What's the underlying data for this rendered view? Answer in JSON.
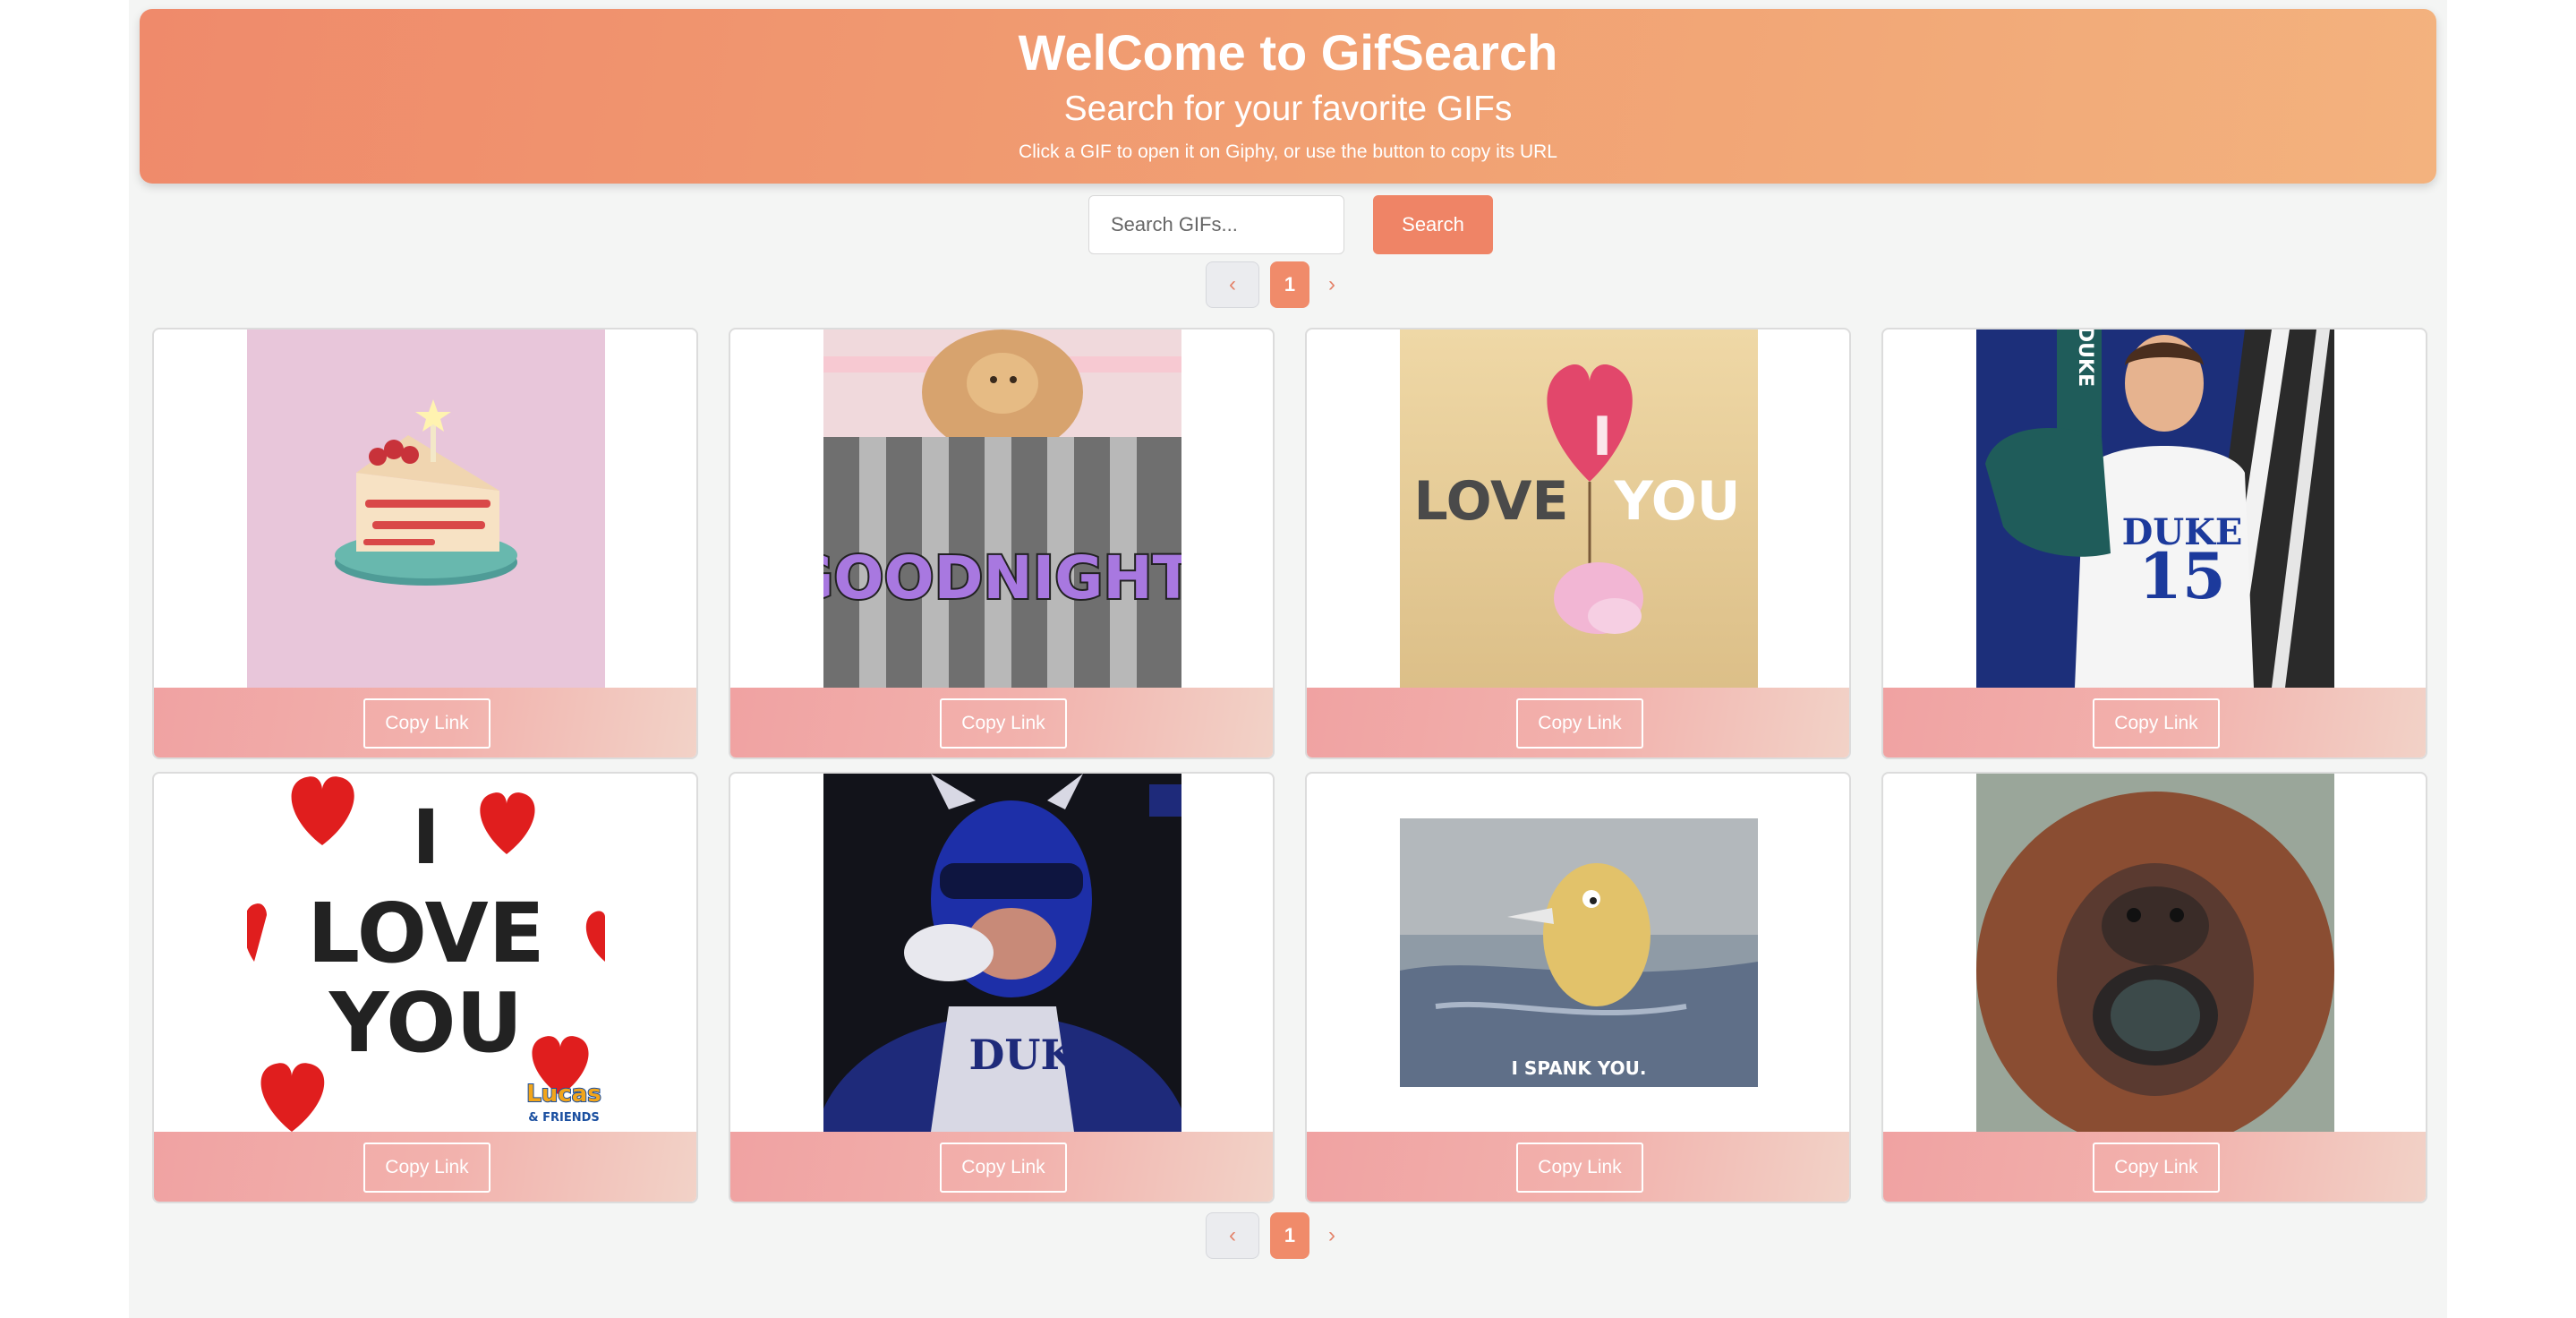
{
  "header": {
    "title": "WelCome to GifSearch",
    "subtitle": "Search for your favorite GIFs",
    "hint": "Click a GIF to open it on Giphy, or use the button to copy its URL"
  },
  "search": {
    "placeholder": "Search GIFs...",
    "value": "",
    "button_label": "Search"
  },
  "pagination": {
    "prev": "‹",
    "current_page": "1",
    "next": "›"
  },
  "gifs": [
    {
      "copy_label": "Copy Link"
    },
    {
      "copy_label": "Copy Link",
      "caption": "GOODNIGHT!"
    },
    {
      "copy_label": "Copy Link",
      "caption_left": "LOVE",
      "caption_right": "YOU",
      "balloon": "I"
    },
    {
      "copy_label": "Copy Link",
      "foam_finger": "DUKE",
      "jersey_team": "DUKE",
      "jersey_number": "15"
    },
    {
      "copy_label": "Copy Link",
      "line1": "I",
      "line2": "LOVE",
      "line3": "YOU",
      "brand": "Lucas",
      "brand_sub": "& FRIENDS"
    },
    {
      "copy_label": "Copy Link",
      "jersey_team": "DUKE"
    },
    {
      "copy_label": "Copy Link",
      "caption": "I SPANK YOU."
    },
    {
      "copy_label": "Copy Link"
    }
  ],
  "colors": {
    "accent": "#ef8466",
    "header_gradient_start": "#ef8a6b",
    "header_gradient_end": "#f3b27e",
    "card_bar_start": "#f0a2a2",
    "card_bar_end": "#f2d2c7"
  }
}
